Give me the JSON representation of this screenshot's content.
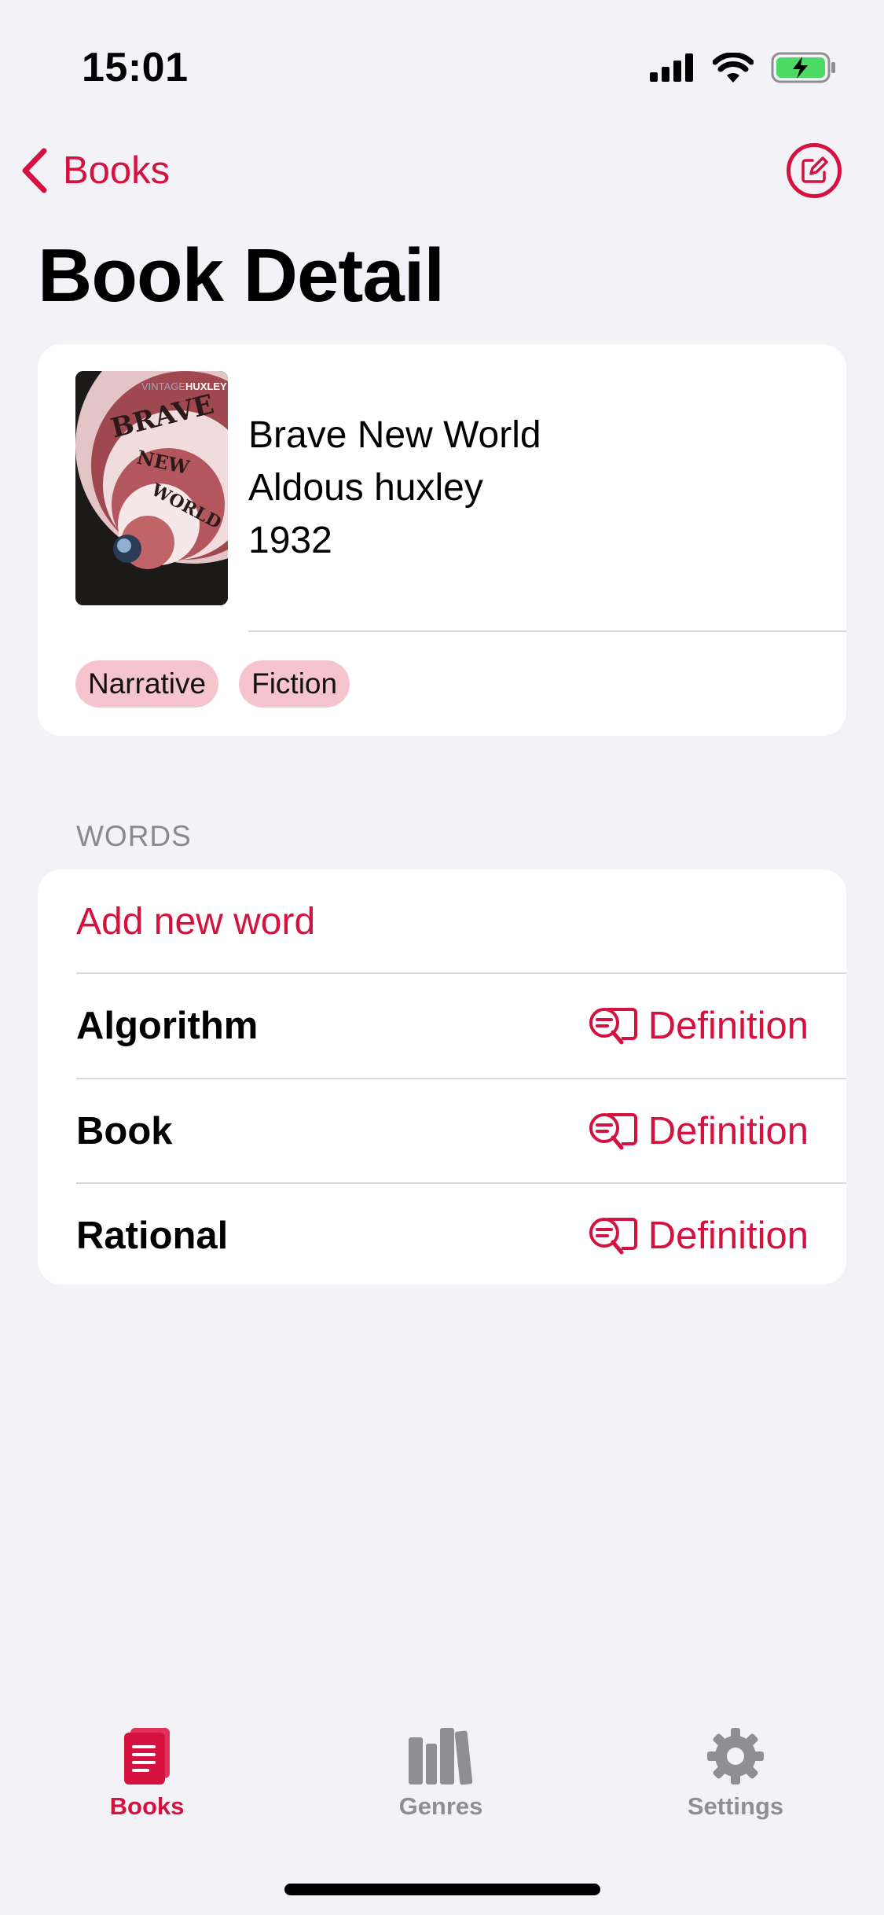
{
  "status_bar": {
    "time": "15:01"
  },
  "nav": {
    "back_label": "Books",
    "title": "Book Detail"
  },
  "book": {
    "title": "Brave New World",
    "author": "Aldous huxley",
    "year": "1932",
    "cover_text": {
      "publisher": "VINTAGE",
      "author": "HUXLEY",
      "line1": "BRAVE",
      "line2": "NEW",
      "line3": "WORLD"
    },
    "tags": [
      "Narrative",
      "Fiction"
    ]
  },
  "words_section": {
    "header": "WORDS",
    "add_label": "Add new word",
    "definition_label": "Definition",
    "words": [
      "Algorithm",
      "Book",
      "Rational"
    ]
  },
  "tabbar": {
    "tabs": [
      {
        "label": "Books",
        "icon": "book-icon",
        "active": true
      },
      {
        "label": "Genres",
        "icon": "books-shelf-icon",
        "active": false
      },
      {
        "label": "Settings",
        "icon": "gear-icon",
        "active": false
      }
    ]
  },
  "colors": {
    "accent": "#d5123f",
    "background": "#f2f2f7",
    "tag": "#f6c4cd",
    "inactive": "#8e8e93"
  }
}
